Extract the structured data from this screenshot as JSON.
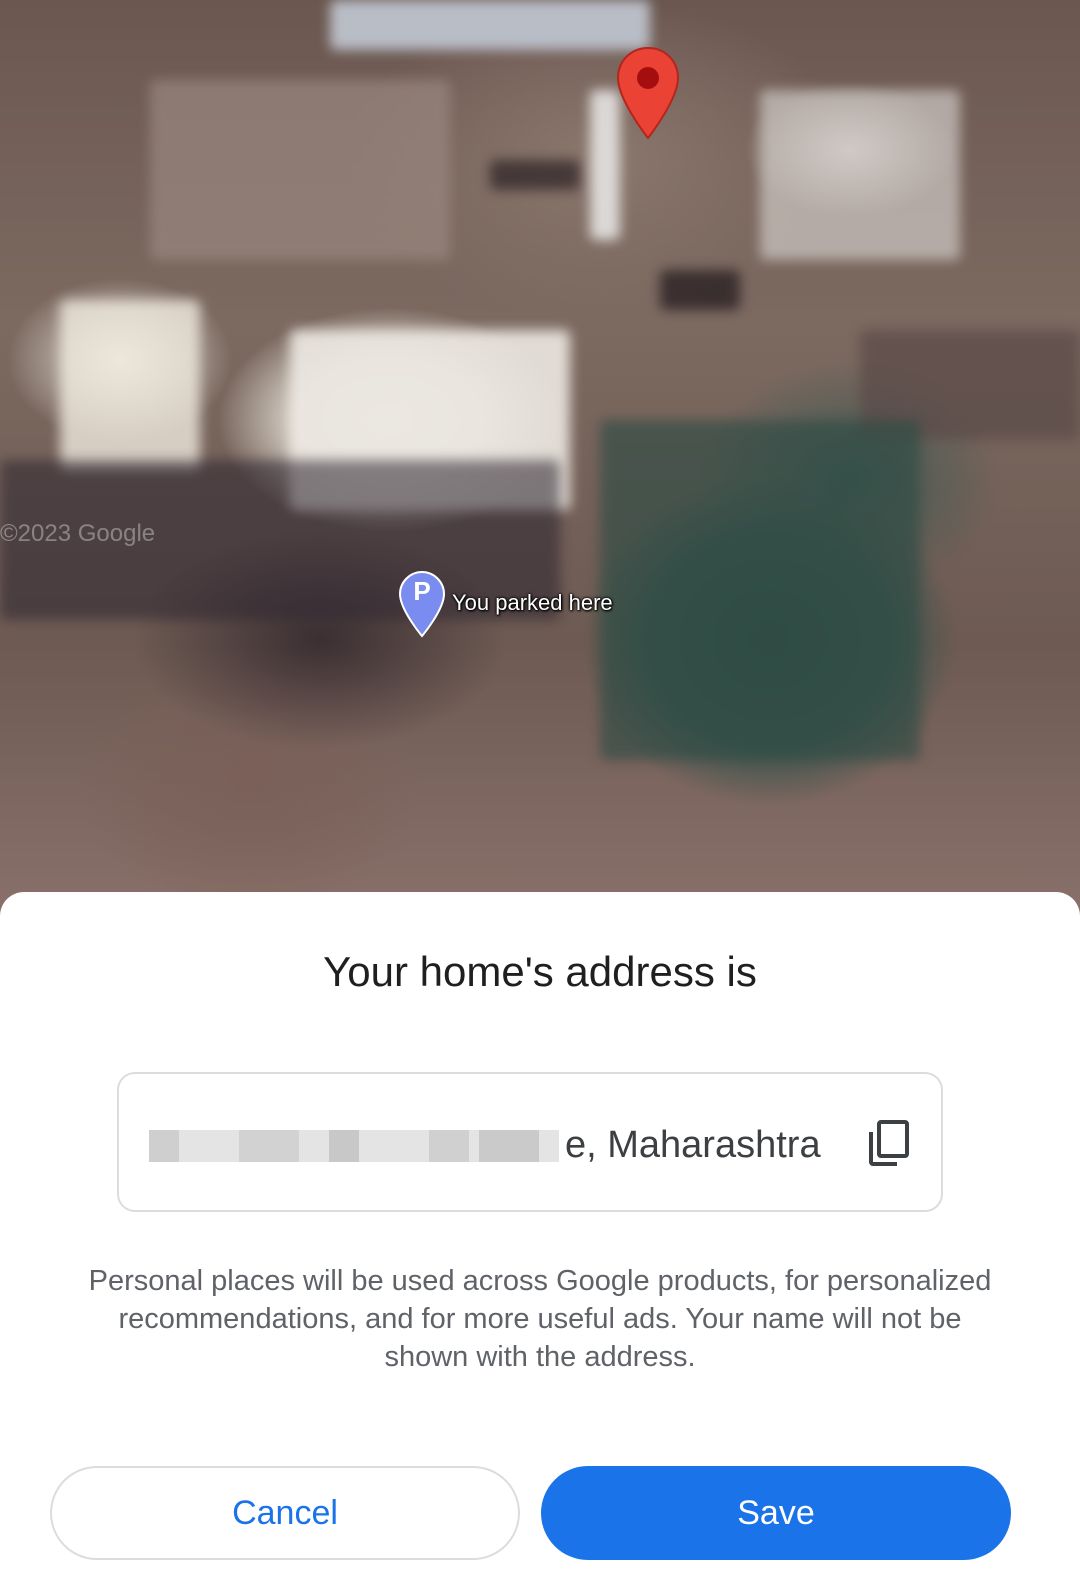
{
  "map": {
    "watermark": "©2023 Google",
    "parked_label": "You parked here",
    "parking_pin_letter": "P",
    "pin_color": "#ea4335",
    "parking_pin_color": "#7b8cf0"
  },
  "dialog": {
    "title": "Your home's address is",
    "address_visible_text": "e, Maharashtra",
    "address_redacted": true,
    "copy_icon": "copy-icon",
    "disclaimer": "Personal places will be used across Google products, for personalized recommendations, and for more useful ads. Your name will not be shown with the address.",
    "cancel_label": "Cancel",
    "save_label": "Save",
    "accent_color": "#1a73e8"
  }
}
